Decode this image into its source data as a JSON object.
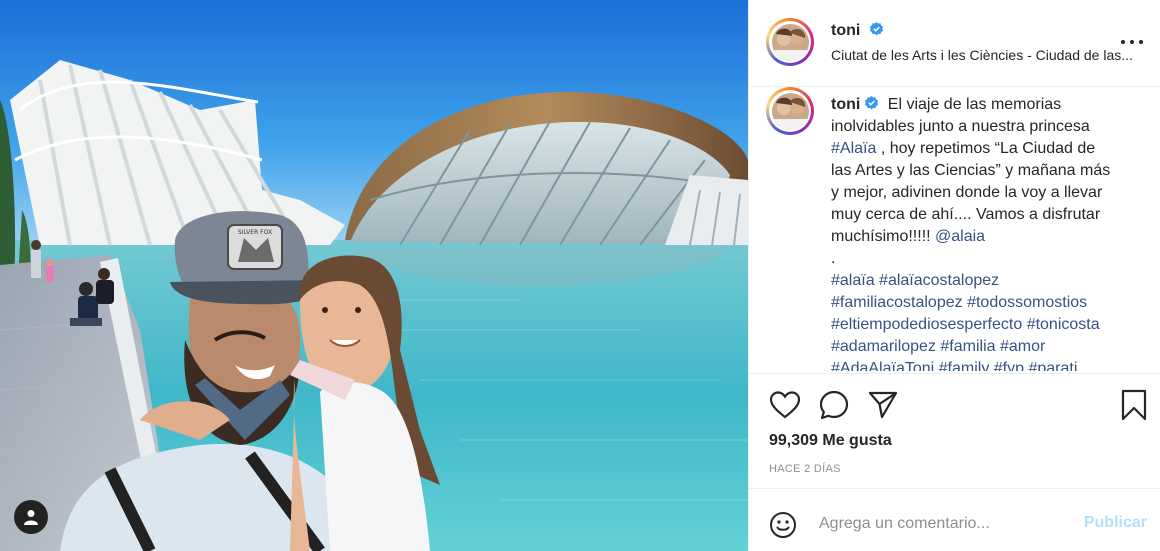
{
  "post": {
    "username": "toni",
    "location": "Ciutat de les Arts i les Ciències - Ciudad de las...",
    "caption_lines": [
      "El viaje de las memorias",
      "inolvidables junto a nuestra princesa",
      "#Alaïa",
      ", hoy repetimos “La Ciudad de",
      "las Artes y las Ciencias” y mañana más",
      "y mejor, adivinen donde la voy a llevar",
      "muy cerca de ahí.... Vamos a disfrutar",
      "muchísimo!!!!!",
      "@alaia",
      "."
    ],
    "hashtags": [
      [
        "#alaïa",
        "#alaïacostalopez"
      ],
      [
        "#familiacostalopez",
        "#todossomostios"
      ],
      [
        "#eltiempodediosesperfecto",
        "#tonicosta"
      ],
      [
        "#adamarilopez",
        "#familia",
        "#amor"
      ],
      [
        "#AdaAlaïaToni",
        "#family",
        "#fyp",
        "#parati"
      ]
    ],
    "likes": "99,309 Me gusta",
    "time": "HACE 2 DÍAS",
    "comment_placeholder": "Agrega un comentario...",
    "publish_label": "Publicar",
    "photo_cap_text": "SILVER FOX"
  },
  "icons": {
    "verified": "verified-badge-icon",
    "more": "more-options-icon",
    "like": "heart-icon",
    "comment": "comment-bubble-icon",
    "share": "paper-plane-icon",
    "save": "bookmark-icon",
    "emoji": "smiley-face-icon",
    "user_tag": "user-tag-icon"
  },
  "colors": {
    "link": "#385185",
    "verified": "#3897f0",
    "publish_disabled": "#b2dffc",
    "meta_gray": "#8e8e8e"
  }
}
